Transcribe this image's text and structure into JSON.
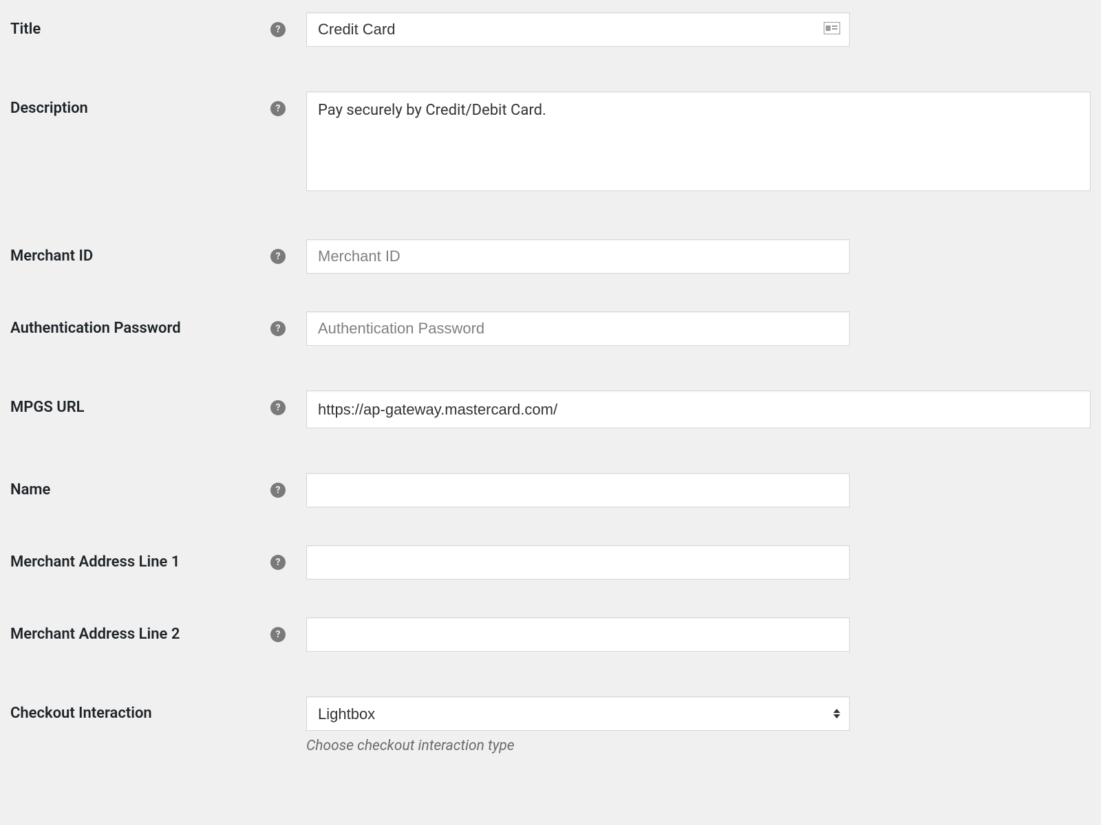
{
  "fields": {
    "title": {
      "label": "Title",
      "value": "Credit Card"
    },
    "description": {
      "label": "Description",
      "value": "Pay securely by Credit/Debit Card."
    },
    "merchant_id": {
      "label": "Merchant ID",
      "value": "",
      "placeholder": "Merchant ID"
    },
    "auth_password": {
      "label": "Authentication Password",
      "value": "",
      "placeholder": "Authentication Password"
    },
    "mpgs_url": {
      "label": "MPGS URL",
      "value": "https://ap-gateway.mastercard.com/"
    },
    "name": {
      "label": "Name",
      "value": ""
    },
    "addr1": {
      "label": "Merchant Address Line 1",
      "value": ""
    },
    "addr2": {
      "label": "Merchant Address Line 2",
      "value": ""
    },
    "checkout": {
      "label": "Checkout Interaction",
      "selected": "Lightbox",
      "helper": "Choose checkout interaction type"
    }
  },
  "help_glyph": "?"
}
